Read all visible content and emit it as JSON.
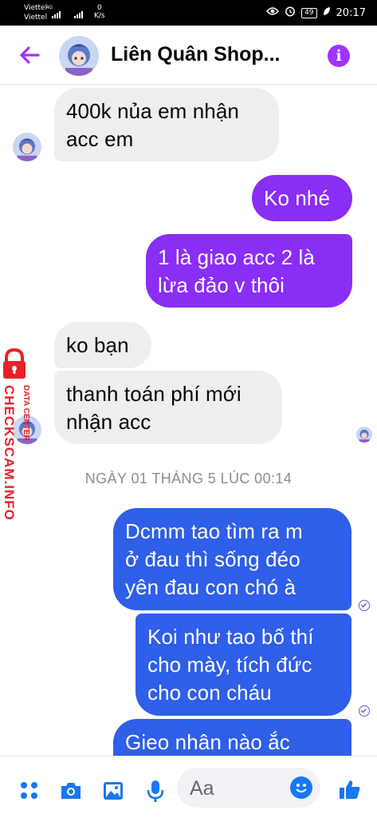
{
  "status": {
    "carrier1": "Viettel",
    "carrier2": "Viettel",
    "network": "4G",
    "speed_value": "0",
    "speed_unit": "K/s",
    "battery": "49",
    "time": "20:17"
  },
  "header": {
    "title": "Liên Quân Shop..."
  },
  "messages": [
    {
      "text1": "400k nủa em nhận",
      "text2": "acc em"
    },
    {
      "text1": "Ko nhé"
    },
    {
      "text1": "1 là giao acc 2 là",
      "text2": "lừa đảo v thôi"
    },
    {
      "text1": "ko bạn"
    },
    {
      "text1": "thanh toán phí mới",
      "text2": "nhận acc"
    },
    {
      "text1": "Dcmm tao tìm ra m",
      "text2": "ở đau thì sống đéo",
      "text3": "yên đau con chó à"
    },
    {
      "text1": "Koi như tao bố thí",
      "text2": "cho mày, tích đức",
      "text3": "cho con cháu"
    },
    {
      "text1": "Gieo nhân nào ắc"
    }
  ],
  "date_separator": "NGÀY 01 THÁNG 5 LÚC 00:14",
  "watermark": {
    "line1": "DATA CENTER",
    "line2": "CHECKSCAM.INFO"
  },
  "composer": {
    "placeholder": "Aa"
  },
  "colors": {
    "accent_purple": "#a033ff",
    "bubble_purple": "#8a2df5",
    "bubble_blue": "#2f5fe8",
    "incoming_bg": "#eeeeef",
    "composer_icon": "#1877f2",
    "watermark_red": "#e8202a"
  },
  "icons": [
    "back-arrow-icon",
    "info-icon",
    "apps-icon",
    "camera-icon",
    "image-icon",
    "mic-icon",
    "emoji-icon",
    "like-icon",
    "seen-check-icon",
    "lock-icon"
  ]
}
